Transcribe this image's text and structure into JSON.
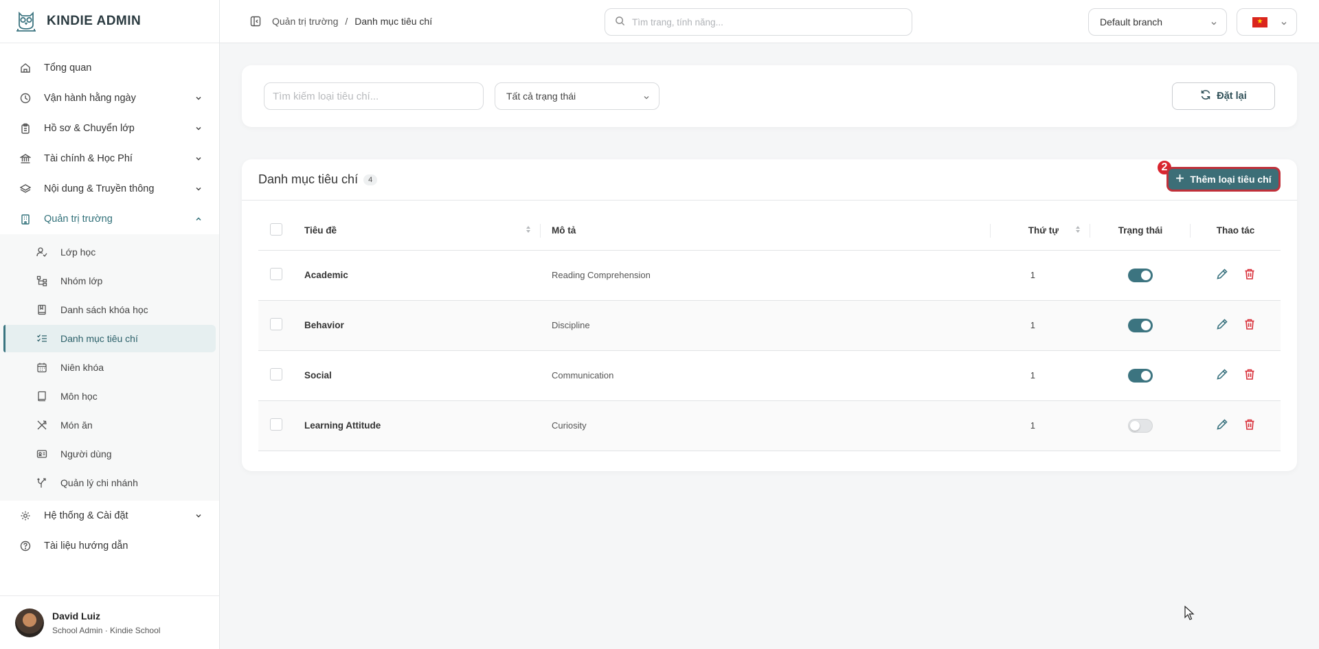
{
  "brand": {
    "title": "KINDIE ADMIN"
  },
  "sidebar": {
    "items": [
      {
        "label": "Tổng quan",
        "icon": "home-icon"
      },
      {
        "label": "Vận hành hằng ngày",
        "icon": "clock-icon"
      },
      {
        "label": "Hồ sơ & Chuyển lớp",
        "icon": "clipboard-icon"
      },
      {
        "label": "Tài chính & Học Phí",
        "icon": "bank-icon"
      },
      {
        "label": "Nội dung & Truyền thông",
        "icon": "layers-icon"
      },
      {
        "label": "Quản trị trường",
        "icon": "building-icon"
      },
      {
        "label": "Hệ thống & Cài đặt",
        "icon": "gear-icon"
      },
      {
        "label": "Tài liệu hướng dẫn",
        "icon": "help-circle-icon"
      }
    ],
    "subitems": [
      {
        "label": "Lớp học",
        "icon": "user-check-icon"
      },
      {
        "label": "Nhóm lớp",
        "icon": "tree-icon"
      },
      {
        "label": "Danh sách khóa học",
        "icon": "book-bookmark-icon"
      },
      {
        "label": "Danh mục tiêu chí",
        "icon": "checklist-icon"
      },
      {
        "label": "Niên khóa",
        "icon": "calendar-icon"
      },
      {
        "label": "Môn học",
        "icon": "book-icon"
      },
      {
        "label": "Món ăn",
        "icon": "utensils-icon"
      },
      {
        "label": "Người dùng",
        "icon": "id-card-icon"
      },
      {
        "label": "Quản lý chi nhánh",
        "icon": "branch-icon"
      }
    ]
  },
  "user": {
    "name": "David Luiz",
    "role": "School Admin · Kindie School"
  },
  "header": {
    "breadcrumb": [
      "Quản trị trường",
      "/",
      "Danh mục tiêu chí"
    ],
    "search_placeholder": "Tìm trang, tính năng...",
    "branch": "Default branch"
  },
  "filters": {
    "search_placeholder": "Tìm kiếm loại tiêu chí...",
    "status": "Tất cả trạng thái",
    "reset_label": "Đặt lại"
  },
  "table_card": {
    "title": "Danh mục tiêu chí",
    "count": "4",
    "add_label": "Thêm loại tiêu chí",
    "step": "2",
    "columns": [
      "Tiêu đề",
      "Mô tả",
      "Thứ tự",
      "Trạng thái",
      "Thao tác"
    ],
    "rows": [
      {
        "title": "Academic",
        "desc": "Reading Comprehension",
        "order": "1",
        "active": true
      },
      {
        "title": "Behavior",
        "desc": "Discipline",
        "order": "1",
        "active": true
      },
      {
        "title": "Social",
        "desc": "Communication",
        "order": "1",
        "active": true
      },
      {
        "title": "Learning Attitude",
        "desc": "Curiosity",
        "order": "1",
        "active": false
      }
    ]
  },
  "colors": {
    "accent": "#3c6e77",
    "danger": "#d9252f"
  }
}
